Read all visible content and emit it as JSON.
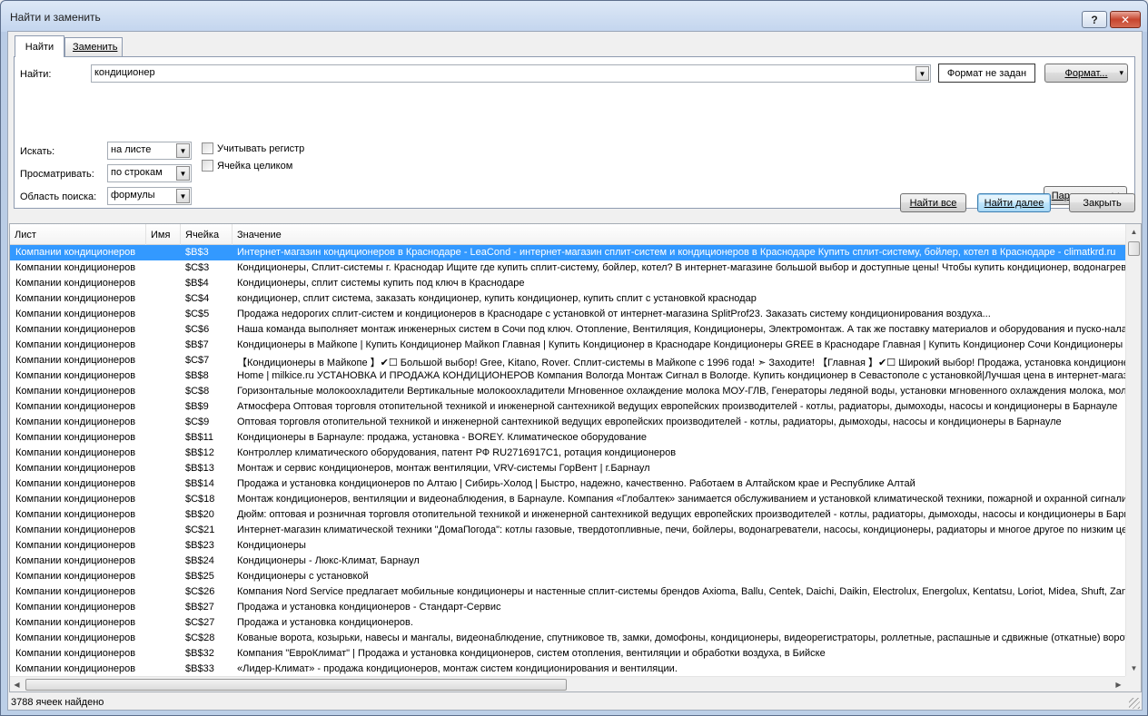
{
  "window": {
    "title": "Найти и заменить",
    "help_glyph": "?",
    "close_glyph": "✕"
  },
  "tabs": {
    "find": "Найти",
    "replace": "Заменить"
  },
  "find": {
    "label": "Найти:",
    "value": "кондиционер",
    "format_status": "Формат не задан",
    "format_button": "Формат...",
    "format_arrow": "▾"
  },
  "options": {
    "within_label": "Искать:",
    "within_value": "на листе",
    "search_label": "Просматривать:",
    "search_value": "по строкам",
    "lookin_label": "Область поиска:",
    "lookin_value": "формулы",
    "match_case": "Учитывать регистр",
    "match_case_checked": false,
    "entire_cell": "Ячейка целиком",
    "entire_cell_checked": false,
    "params_button": "Параметры <<"
  },
  "actions": {
    "find_all": "Найти все",
    "find_next": "Найти далее",
    "close": "Закрыть"
  },
  "results": {
    "columns": {
      "sheet": "Лист",
      "name": "Имя",
      "cell": "Ячейка",
      "value": "Значение"
    },
    "rows": [
      {
        "sheet": "Компании кондиционеров",
        "name": "",
        "cell": "$B$3",
        "value": "Интернет-магазин кондиционеров в Краснодаре - LeaCond - интернет-магазин сплит-систем и кондиционеров в Краснодаре Купить сплит-систему, бойлер, котел в Краснодаре - climatkrd.ru",
        "selected": true
      },
      {
        "sheet": "Компании кондиционеров",
        "name": "",
        "cell": "$C$3",
        "value": "Кондиционеры, Сплит-системы г. Краснодар Ищите где купить сплит-систему, бойлер, котел? В интернет-магазине большой выбор и доступные цены! Чтобы купить кондиционер, водонагреватель"
      },
      {
        "sheet": "Компании кондиционеров",
        "name": "",
        "cell": "$B$4",
        "value": "Кондиционеры, сплит системы купить под ключ в Краснодаре"
      },
      {
        "sheet": "Компании кондиционеров",
        "name": "",
        "cell": "$C$4",
        "value": "кондиционер, сплит система, заказать кондиционер, купить кондиционер, купить сплит с установкой краснодар"
      },
      {
        "sheet": "Компании кондиционеров",
        "name": "",
        "cell": "$C$5",
        "value": "Продажа недорогих сплит-систем и кондиционеров в Краснодаре с установкой от интернет-магазина SplitProf23. Заказать систему кондиционирования воздуха..."
      },
      {
        "sheet": "Компании кондиционеров",
        "name": "",
        "cell": "$C$6",
        "value": "Наша команда выполняет монтаж инженерных систем в Сочи под ключ. Отопление, Вентиляция, Кондиционеры, Электромонтаж. А так же поставку материалов и оборудования и пуско-наладку"
      },
      {
        "sheet": "Компании кондиционеров",
        "name": "",
        "cell": "$B$7",
        "value": "Кондиционеры в Майкопе | Купить Кондиционер Майкоп Главная | Купить Кондиционер в Краснодаре Кондиционеры GREE в Краснодаре Главная | Купить Кондиционер Сочи Кондиционеры"
      },
      {
        "sheet": "Компании кондиционеров",
        "name": "",
        "cell": "$C$7",
        "value": "【Кондиционеры в Майкопе 】✔☐ Большой выбор! Gree, Kitano, Rover. Сплит-системы в Майкопе с 1996 года! ➣ Заходите! 【Главная 】✔☐ Широкий выбор! Продажа, установка кондиционеров"
      },
      {
        "sheet": "Компании кондиционеров",
        "name": "",
        "cell": "$B$8",
        "value": "Home | milkice.ru УСТАНОВКА И ПРОДАЖА КОНДИЦИОНЕРОВ Компания Вологда Монтаж Сигнал в Вологде. Купить кондиционер в Севастополе с установкой|Лучшая цена в интернет-магазине"
      },
      {
        "sheet": "Компании кондиционеров",
        "name": "",
        "cell": "$C$8",
        "value": "Горизонтальные молокоохладители Вертикальные молокоохладители Мгновенное охлаждение молока МОУ-ГЛВ, Генераторы ледяной воды, установки мгновенного охлаждения молока, молокоохладители"
      },
      {
        "sheet": "Компании кондиционеров",
        "name": "",
        "cell": "$B$9",
        "value": "Атмосфера Оптовая торговля отопительной техникой и инженерной сантехникой ведущих европейских производителей - котлы, радиаторы, дымоходы, насосы и кондиционеры в Барнауле"
      },
      {
        "sheet": "Компании кондиционеров",
        "name": "",
        "cell": "$C$9",
        "value": "Оптовая торговля отопительной техникой и инженерной сантехникой ведущих европейских производителей - котлы, радиаторы, дымоходы, насосы и кондиционеры в Барнауле"
      },
      {
        "sheet": "Компании кондиционеров",
        "name": "",
        "cell": "$B$11",
        "value": "Кондиционеры в Барнауле: продажа, установка - BOREY. Климатическое оборудование"
      },
      {
        "sheet": "Компании кондиционеров",
        "name": "",
        "cell": "$B$12",
        "value": "Контроллер климатического оборудования, патент РФ RU2716917C1, ротация кондиционеров"
      },
      {
        "sheet": "Компании кондиционеров",
        "name": "",
        "cell": "$B$13",
        "value": "Монтаж и сервис кондиционеров, монтаж вентиляции, VRV-системы ГорВент | г.Барнаул"
      },
      {
        "sheet": "Компании кондиционеров",
        "name": "",
        "cell": "$B$14",
        "value": "Продажа и установка кондиционеров по Алтаю | Сибирь-Холод | Быстро, надежно, качественно. Работаем в Алтайском крае и Республике Алтай"
      },
      {
        "sheet": "Компании кондиционеров",
        "name": "",
        "cell": "$C$18",
        "value": "Монтаж кондиционеров, вентиляции и видеонаблюдения, в Барнауле. Компания «Глобалтек» занимается обслуживанием и установкой климатической техники, пожарной и охранной сигнализации"
      },
      {
        "sheet": "Компании кондиционеров",
        "name": "",
        "cell": "$B$20",
        "value": "Дюйм: оптовая и розничная торговля отопительной техникой и инженерной сантехникой ведущих европейских производителей - котлы, радиаторы, дымоходы, насосы и кондиционеры в Барнауле"
      },
      {
        "sheet": "Компании кондиционеров",
        "name": "",
        "cell": "$C$21",
        "value": "Интернет-магазин климатической техники \"ДомаПогода\": котлы газовые, твердотопливные, печи, бойлеры, водонагреватели, насосы, кондиционеры, радиаторы и многое другое по низким ценам"
      },
      {
        "sheet": "Компании кондиционеров",
        "name": "",
        "cell": "$B$23",
        "value": "Кондиционеры"
      },
      {
        "sheet": "Компании кондиционеров",
        "name": "",
        "cell": "$B$24",
        "value": "Кондиционеры - Люкс-Климат, Барнаул"
      },
      {
        "sheet": "Компании кондиционеров",
        "name": "",
        "cell": "$B$25",
        "value": "Кондиционеры с установкой"
      },
      {
        "sheet": "Компании кондиционеров",
        "name": "",
        "cell": "$C$26",
        "value": "Компания Nord Service предлагает мобильные кондиционеры и настенные сплит-системы брендов Axioma, Ballu, Centek, Daichi, Daikin, Electrolux, Energolux, Kentatsu, Loriot, Midea, Shuft, Zanussi"
      },
      {
        "sheet": "Компании кондиционеров",
        "name": "",
        "cell": "$B$27",
        "value": "Продажа и установка кондиционеров - Стандарт-Сервис"
      },
      {
        "sheet": "Компании кондиционеров",
        "name": "",
        "cell": "$C$27",
        "value": "Продажа и установка кондиционеров."
      },
      {
        "sheet": "Компании кондиционеров",
        "name": "",
        "cell": "$C$28",
        "value": "Кованые ворота, козырьки, навесы и мангалы, видеонаблюдение, спутниковое тв, замки, домофоны, кондиционеры, видеорегистраторы, роллетные, распашные и сдвижные (откатные) ворота"
      },
      {
        "sheet": "Компании кондиционеров",
        "name": "",
        "cell": "$B$32",
        "value": "Компания \"ЕвроКлимат\" | Продажа и установка кондиционеров, систем отопления, вентиляции и обработки воздуха, в Бийске"
      },
      {
        "sheet": "Компании кондиционеров",
        "name": "",
        "cell": "$B$33",
        "value": "«Лидер-Климат» - продажа кондиционеров, монтаж систем кондиционирования и вентиляции."
      }
    ]
  },
  "status": "3788 ячеек найдено",
  "colors": {
    "selection": "#3399ff",
    "titlebar": "#c3d5ee",
    "close": "#c7462f"
  }
}
